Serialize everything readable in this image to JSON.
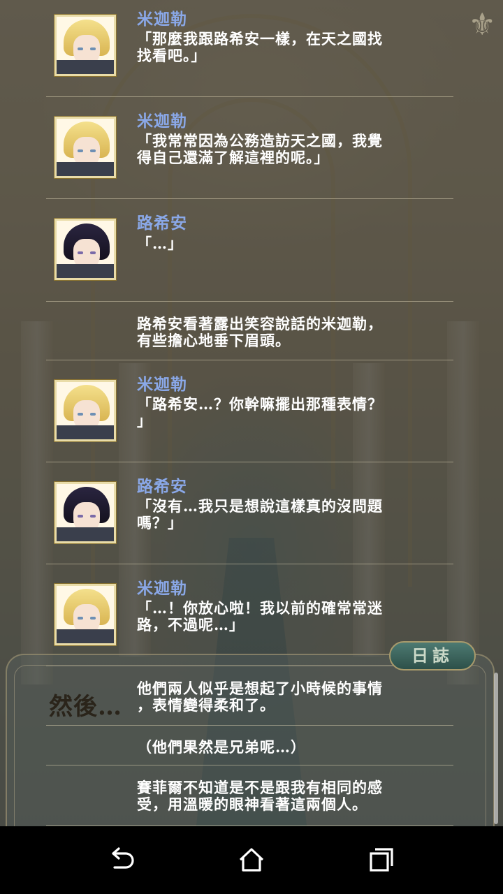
{
  "log_tab_label": "日誌",
  "then_text": "然後…",
  "entries": [
    {
      "speaker": "米迦勒",
      "portrait": "mikael-portrait",
      "text": "「那麼我跟路希安一樣，在天之國找\n找看吧。」"
    },
    {
      "speaker": "米迦勒",
      "portrait": "mikael-portrait",
      "text": "「我常常因為公務造訪天之國，我覺\n得自己還滿了解這裡的呢。」"
    },
    {
      "speaker": "路希安",
      "portrait": "lucien-portrait",
      "text": "「…」"
    },
    {
      "speaker": "",
      "portrait": "",
      "text": "路希安看著露出笑容說話的米迦勒，\n有些擔心地垂下眉頭。"
    },
    {
      "speaker": "米迦勒",
      "portrait": "mikael-portrait",
      "text": "「路希安…？你幹嘛擺出那種表情？\n」"
    },
    {
      "speaker": "路希安",
      "portrait": "lucien-portrait",
      "text": "「沒有…我只是想說這樣真的沒問題\n嗎？」"
    },
    {
      "speaker": "米迦勒",
      "portrait": "mikael-portrait",
      "text": "「…！你放心啦！我以前的確常常迷\n路，不過呢…」"
    },
    {
      "speaker": "",
      "portrait": "",
      "text": "他們兩人似乎是想起了小時候的事情\n，表情變得柔和了。"
    },
    {
      "speaker": "",
      "portrait": "",
      "text": "（他們果然是兄弟呢…）"
    },
    {
      "speaker": "",
      "portrait": "",
      "text": "賽菲爾不知道是不是跟我有相同的感\n受，用溫暖的眼神看著這兩個人。"
    }
  ],
  "nav": {
    "back": "back-icon",
    "home": "home-icon",
    "recents": "recents-icon"
  }
}
